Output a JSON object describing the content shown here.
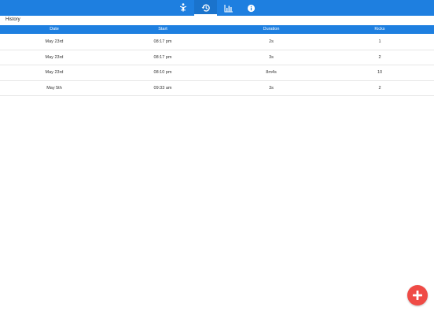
{
  "colors": {
    "primary": "#1e7fe0",
    "primary_active": "#1a73cc",
    "fab": "#ef4b46",
    "header_text": "#ffffff",
    "row_divider": "#e6e6e6"
  },
  "nav": {
    "tabs": [
      {
        "icon": "baby-icon",
        "active": false
      },
      {
        "icon": "history-icon",
        "active": true
      },
      {
        "icon": "bar-chart-icon",
        "active": false
      },
      {
        "icon": "info-icon",
        "active": false
      }
    ]
  },
  "page": {
    "title": "History"
  },
  "table": {
    "columns": [
      "Date",
      "Start",
      "Duration",
      "Kicks"
    ],
    "rows": [
      [
        "May 23rd",
        "08:17 pm",
        "2s",
        "1"
      ],
      [
        "May 23rd",
        "08:17 pm",
        "3s",
        "2"
      ],
      [
        "May 23rd",
        "08:10 pm",
        "8m4s",
        "10"
      ],
      [
        "May 5th",
        "09:33 am",
        "3s",
        "2"
      ]
    ]
  },
  "fab": {
    "icon": "plus-icon"
  }
}
